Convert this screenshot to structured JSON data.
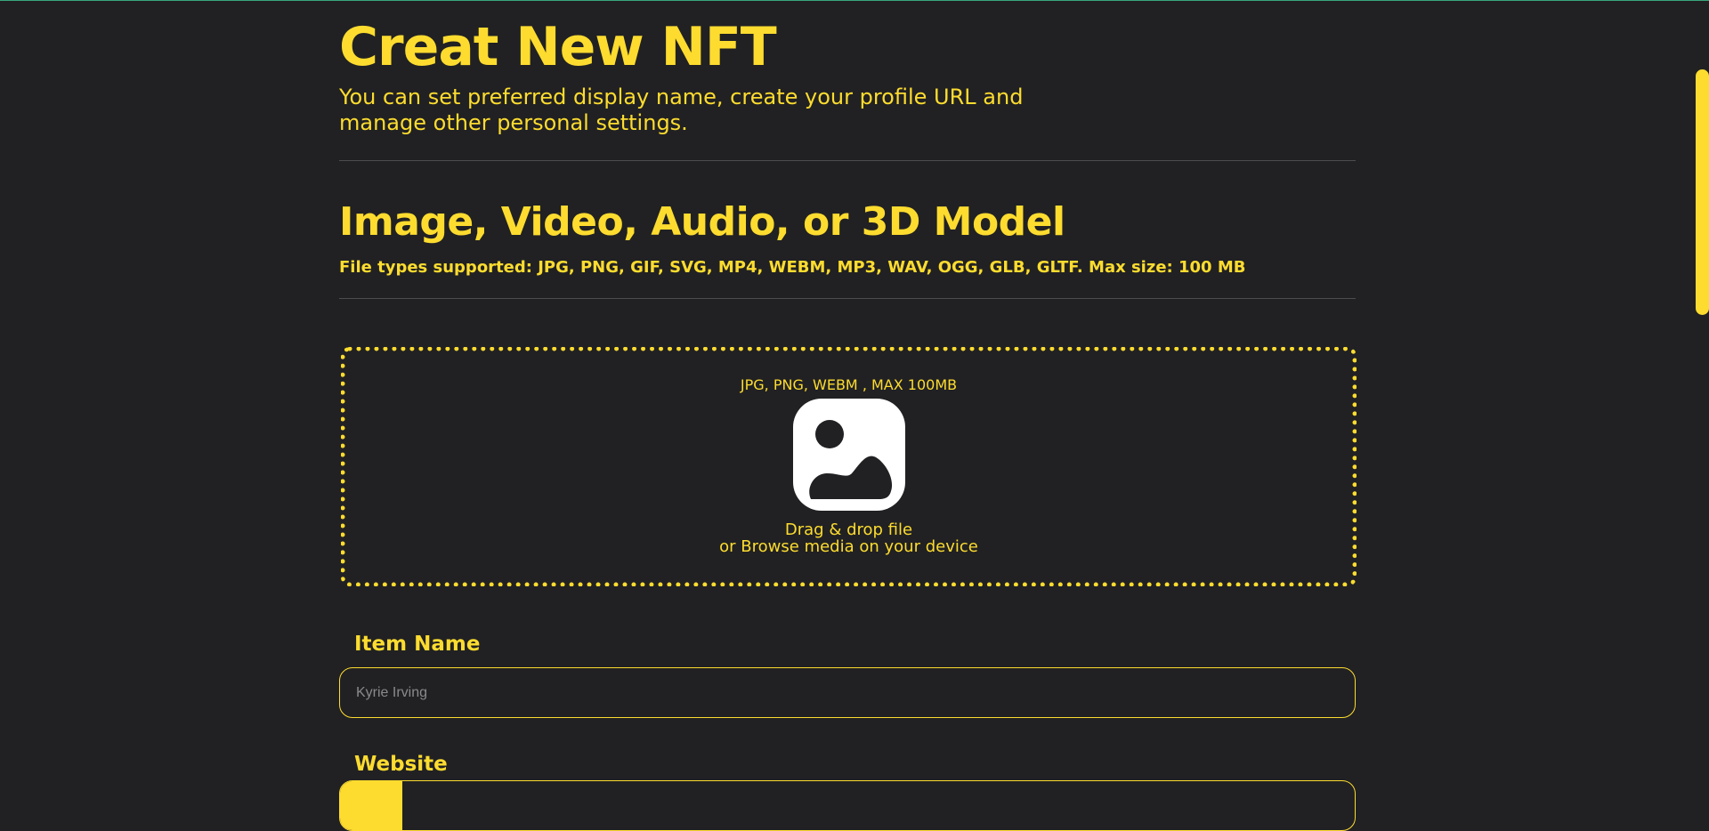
{
  "header": {
    "title": "Creat New NFT",
    "subtitle": "You can set preferred display name, create your profile URL and manage other personal settings."
  },
  "upload_section": {
    "title": "Image, Video, Audio, or 3D Model",
    "description": "File types supported: JPG, PNG, GIF, SVG, MP4, WEBM, MP3, WAV, OGG, GLB, GLTF. Max size: 100 MB",
    "dropzone": {
      "hint": "JPG, PNG, WEBM , MAX 100MB",
      "icon": "image-icon",
      "line1": "Drag & drop file",
      "line2": "or Browse media on your device"
    }
  },
  "form": {
    "item_name": {
      "label": "Item Name",
      "placeholder": "Kyrie Irving",
      "value": ""
    },
    "website": {
      "label": "Website"
    }
  },
  "colors": {
    "background": "#212123",
    "accent": "#fddc2f",
    "divider": "#4d4d50",
    "top_line": "#3aa57e"
  }
}
